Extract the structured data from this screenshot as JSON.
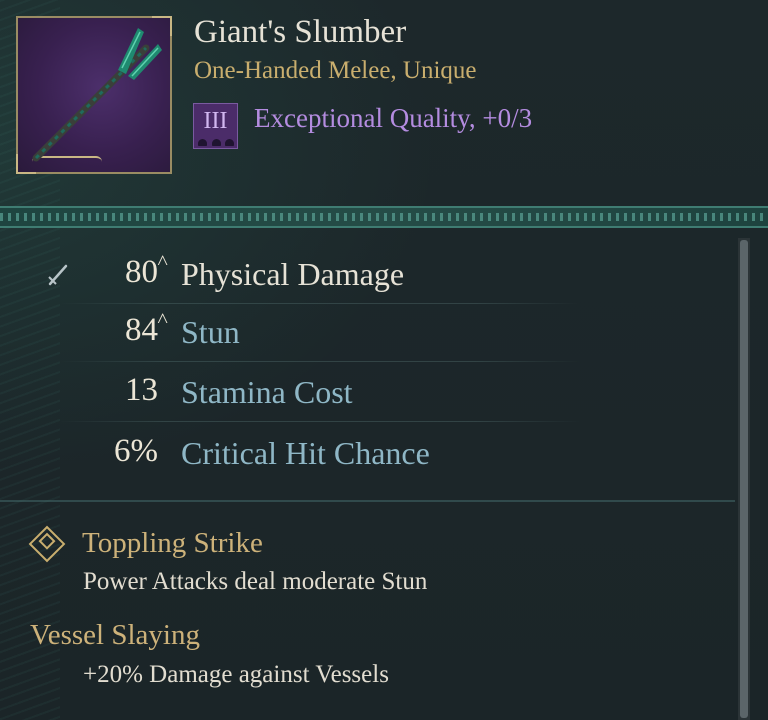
{
  "item": {
    "name": "Giant's Slumber",
    "type_line": "One-Handed Melee, Unique",
    "tier_numeral": "III",
    "quality_text": "Exceptional Quality, +0/3",
    "icon": "spear-icon"
  },
  "stats": [
    {
      "value": "80",
      "arrow": "˄",
      "label": "Physical Damage",
      "icon": "sword-icon"
    },
    {
      "value": "84",
      "arrow": "˄",
      "label": "Stun"
    },
    {
      "value": "13",
      "arrow": "",
      "label": "Stamina Cost"
    },
    {
      "value": "6%",
      "arrow": "",
      "label": "Critical Hit Chance"
    }
  ],
  "traits": [
    {
      "title": "Toppling Strike",
      "description": "Power Attacks deal moderate Stun",
      "icon": "diamond-icon"
    },
    {
      "title": "Vessel Slaying",
      "description": "+20% Damage against Vessels"
    }
  ],
  "colors": {
    "background": "#1c2629",
    "gold": "#c9ae6e",
    "purple_quality": "#b48ce0",
    "stat_blue": "#8fb7c6"
  }
}
